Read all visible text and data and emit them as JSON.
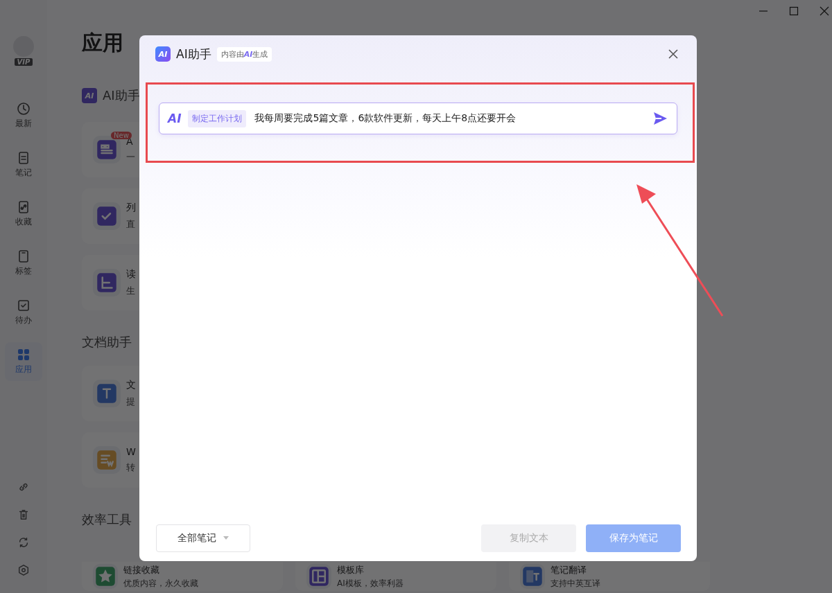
{
  "sidebar": {
    "vip": "VIP",
    "items": [
      {
        "label": "最新",
        "kind": "clock",
        "selected": false
      },
      {
        "label": "笔记",
        "kind": "note",
        "selected": false
      },
      {
        "label": "收藏",
        "kind": "link",
        "selected": false
      },
      {
        "label": "标签",
        "kind": "tag",
        "selected": false
      },
      {
        "label": "待办",
        "kind": "todo",
        "selected": false
      },
      {
        "label": "应用",
        "kind": "apps",
        "selected": true
      }
    ]
  },
  "page": {
    "title": "应用",
    "sections": [
      {
        "title": "AI助手",
        "logo": "AI",
        "cards": [
          {
            "title": "A",
            "subtitle": "一",
            "kind": "quote",
            "badge": "New"
          },
          {
            "title": "列",
            "subtitle": "直",
            "kind": "check"
          },
          {
            "title": "读",
            "subtitle": "生",
            "kind": "book"
          }
        ]
      },
      {
        "title": "文档助手",
        "cards": [
          {
            "title": "文",
            "subtitle": "提",
            "kind": "text"
          },
          {
            "title": "W",
            "subtitle": "转",
            "kind": "word"
          }
        ]
      },
      {
        "title": "效率工具",
        "cards": [
          {
            "title": "链接收藏",
            "subtitle": "优质内容，永久收藏",
            "kind": "star"
          },
          {
            "title": "模板库",
            "subtitle": "AI模板，效率利器",
            "kind": "template"
          },
          {
            "title": "笔记翻译",
            "subtitle": "支持中英互译",
            "kind": "translate"
          }
        ]
      }
    ]
  },
  "dialog": {
    "logo": "AI",
    "title": "AI助手",
    "badge": "内容由**AI**生成",
    "prompt": {
      "logo": "AI",
      "tag": "制定工作计划",
      "value": "我每周要完成5篇文章，6款软件更新，每天上午8点还要开会"
    },
    "notebook_select": "全部笔记",
    "buttons": [
      {
        "label": "复制文本",
        "kind": "secondary",
        "disabled": true
      },
      {
        "label": "保存为笔记",
        "kind": "primary",
        "disabled": true
      }
    ]
  }
}
